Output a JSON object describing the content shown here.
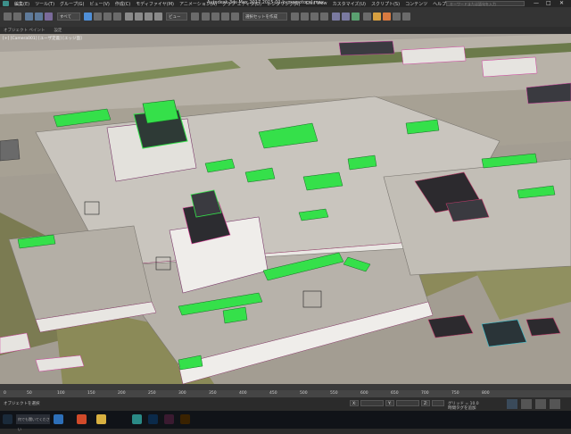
{
  "window": {
    "title": "Autodesk 3ds Max 2017   2015-01-kumamotocel.max",
    "search_placeholder": "キーワードまたは語句を入力",
    "controls": [
      "—",
      "□",
      "✕"
    ]
  },
  "menu": {
    "items": [
      "編集(E)",
      "ツール(T)",
      "グループ(G)",
      "ビュー(V)",
      "作成(C)",
      "モディファイヤ(M)",
      "アニメーション(A)",
      "グラフ エディタ(D)",
      "レンダリング(R)",
      "Civil View",
      "カスタマイズ(U)",
      "スクリプト(S)",
      "コンテンツ",
      "ヘルプ(H)"
    ]
  },
  "toolbar": {
    "selection_filter": "すべて",
    "reference_coord": "ビュー",
    "named_selection": "選択セットを作成"
  },
  "ribbon": {
    "items": [
      "オブジェクト ペイント",
      "設定"
    ]
  },
  "viewport": {
    "label": "[+] [Camera001] [ユーザ定義] [エッジ面]"
  },
  "timeline": {
    "ticks": [
      "0",
      "50",
      "100",
      "150",
      "200",
      "250",
      "300",
      "350",
      "400",
      "450",
      "500",
      "550",
      "600",
      "650",
      "700",
      "750",
      "800"
    ]
  },
  "status": {
    "message": "オブジェクトを選択",
    "grid_label": "グリッド = 10.0",
    "x_label": "X:",
    "y_label": "Y:",
    "z_label": "Z:",
    "add_time_tag": "時間タグを追加"
  },
  "taskbar": {
    "search_placeholder": "何でも聞いてください",
    "apps": [
      "edge-icon",
      "chrome-icon",
      "explorer-icon",
      "3dsmax-icon",
      "photoshop-icon",
      "muse-icon",
      "illustrator-icon"
    ]
  },
  "colors": {
    "accent_green": "#35e04a",
    "ui_dark": "#2b2b2b",
    "viewport_ground": "#a9a39b",
    "wall_light": "#efedea"
  }
}
